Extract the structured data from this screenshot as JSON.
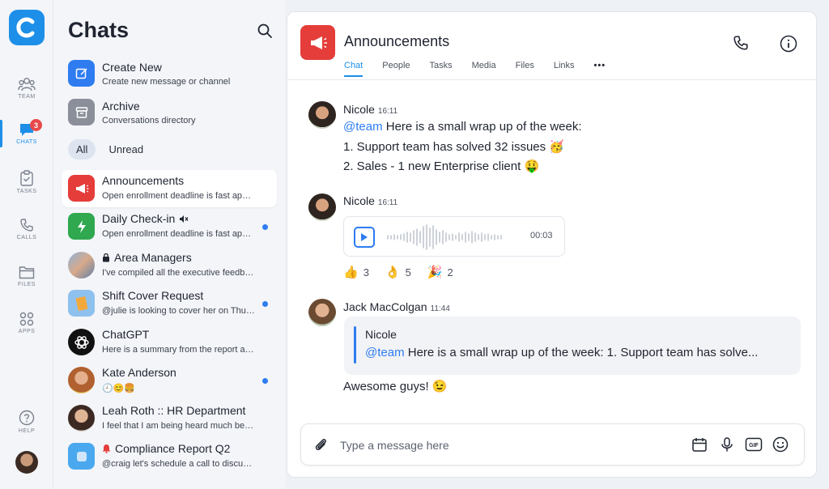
{
  "rail": {
    "items": [
      {
        "label": "TEAM"
      },
      {
        "label": "CHATS",
        "badge": "3"
      },
      {
        "label": "TASKS"
      },
      {
        "label": "CALLS"
      },
      {
        "label": "FILES"
      },
      {
        "label": "APPS"
      }
    ],
    "help_label": "HELP"
  },
  "list": {
    "title": "Chats",
    "quick": [
      {
        "title": "Create New",
        "subtitle": "Create new message or channel"
      },
      {
        "title": "Archive",
        "subtitle": "Conversations directory"
      }
    ],
    "filters": [
      "All",
      "Unread"
    ],
    "conversations": [
      {
        "name": "Announcements",
        "preview": "Open enrollment deadline is fast appro...",
        "unread": false,
        "active": true
      },
      {
        "name": "Daily Check-in",
        "preview": "Open enrollment deadline is fast appro...",
        "unread": true,
        "muted": true
      },
      {
        "name": "Area Managers",
        "preview": "I've compiled all the executive feedback",
        "unread": false,
        "locked": true
      },
      {
        "name": "Shift Cover Request",
        "preview": "@julie is looking to cover her on Thu 4-...",
        "unread": true
      },
      {
        "name": "ChatGPT",
        "preview": "Here is a summary from the report abo...",
        "unread": false
      },
      {
        "name": "Kate Anderson",
        "preview": "🕘😊🍔",
        "unread": true
      },
      {
        "name": "Leah Roth :: HR Department",
        "preview": "I feel that I am being heard much better...",
        "unread": false
      },
      {
        "name": "Compliance Report Q2",
        "preview": "@craig let's schedule a call to discuss t...",
        "unread": false,
        "alert": true
      }
    ]
  },
  "chat": {
    "title": "Announcements",
    "tabs": [
      "Chat",
      "People",
      "Tasks",
      "Media",
      "Files",
      "Links"
    ],
    "tab_more": "•••",
    "messages": [
      {
        "author": "Nicole",
        "time": "16:11",
        "mention": "@team",
        "text1": " Here is a small wrap up of the week:",
        "line2": "1. Support team has solved 32 issues 🥳",
        "line3": "2. Sales - 1 new Enterprise client 🤑"
      },
      {
        "author": "Nicole",
        "time": "16:11",
        "voice_duration": "00:03",
        "reactions": [
          {
            "emoji": "👍",
            "count": "3"
          },
          {
            "emoji": "👌",
            "count": "5"
          },
          {
            "emoji": "🎉",
            "count": "2"
          }
        ]
      },
      {
        "author": "Jack MacColgan",
        "time": "11:44",
        "quote_author": "Nicole",
        "quote_mention": "@team",
        "quote_text": " Here is a small wrap up of the week: 1. Support team has solve...",
        "text": "Awesome guys! 😉"
      }
    ],
    "composer_placeholder": "Type a message here"
  },
  "colors": {
    "accent": "#1d8fe8",
    "mention": "#2e7cf0",
    "announcement": "#e43d3a",
    "badge": "#e84a4a"
  }
}
